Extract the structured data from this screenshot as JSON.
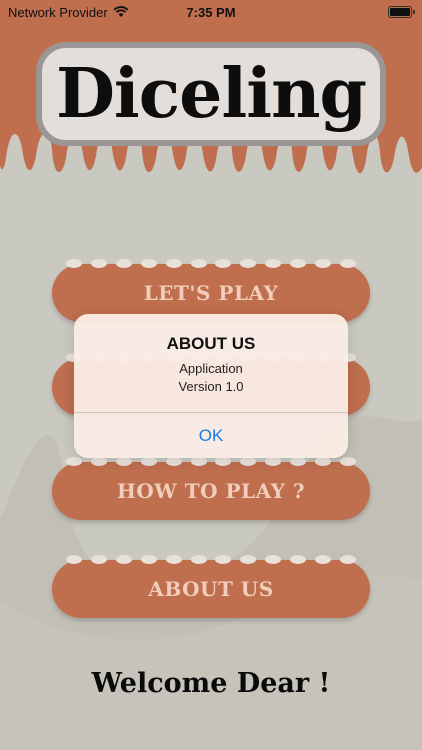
{
  "status_bar": {
    "carrier": "Network Provider",
    "time": "7:35 PM",
    "wifi_icon": "wifi-icon",
    "battery_icon": "battery-icon",
    "battery_level": 1.0
  },
  "header": {
    "app_title": "Diceling"
  },
  "menu": {
    "items": [
      {
        "label": "LET'S PLAY"
      },
      {
        "label": ""
      },
      {
        "label": "HOW TO PLAY ?"
      },
      {
        "label": "ABOUT US"
      }
    ]
  },
  "alert": {
    "title": "ABOUT US",
    "message_line1": "Application",
    "message_line2": "Version 1.0",
    "ok_label": "OK"
  },
  "footer": {
    "welcome": "Welcome Dear !"
  },
  "colors": {
    "background": "#c9c9c1",
    "brand": "#bf6e4e",
    "pill_text": "#f1cdbb",
    "alert_button": "#1f7ae0"
  }
}
